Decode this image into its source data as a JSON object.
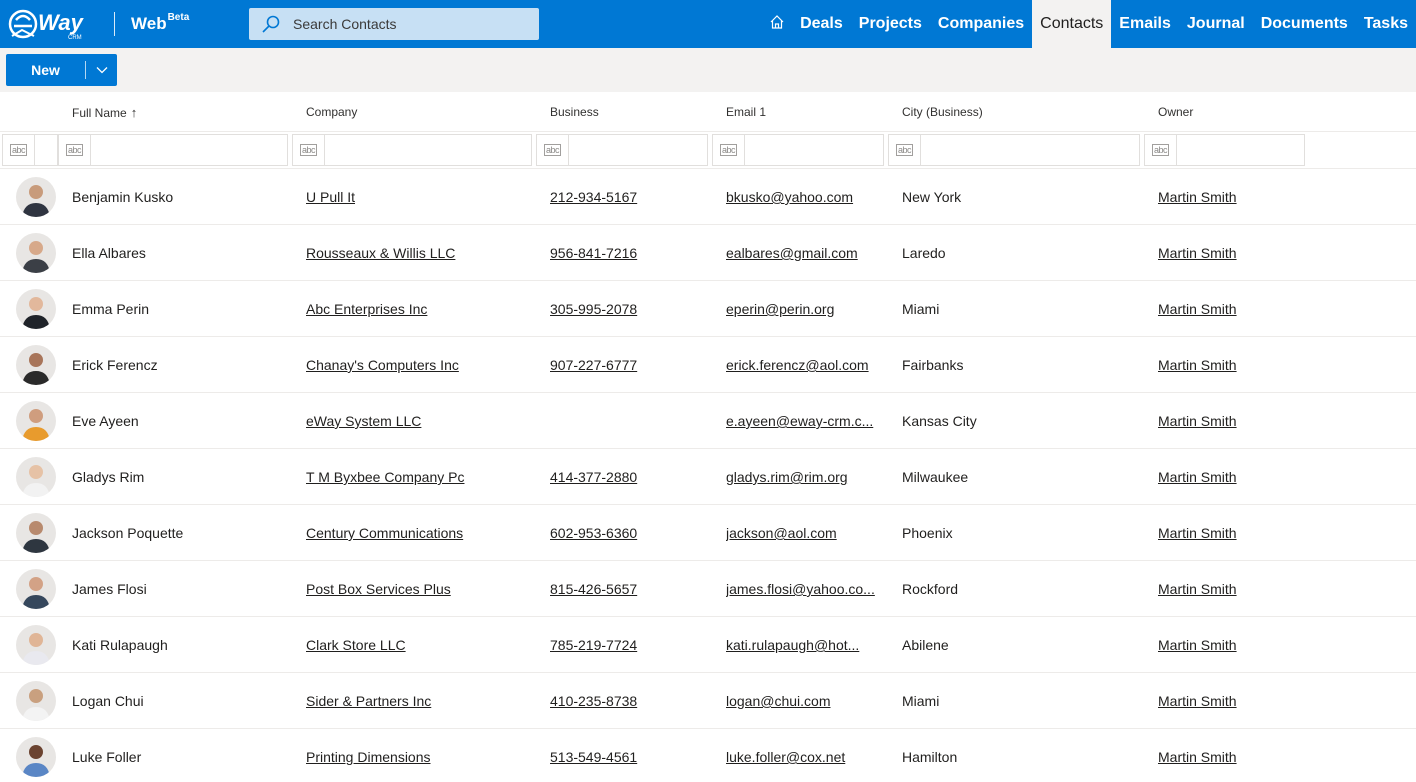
{
  "app": {
    "web_label": "Web",
    "beta_label": "Beta",
    "search_placeholder": "Search Contacts",
    "accent": "#0078d4"
  },
  "nav": {
    "home_icon": "home-icon",
    "items": [
      "Deals",
      "Projects",
      "Companies",
      "Contacts",
      "Emails",
      "Journal",
      "Documents",
      "Tasks"
    ],
    "active": "Contacts"
  },
  "toolbar": {
    "new_label": "New"
  },
  "columns": [
    "Full Name",
    "Company",
    "Business",
    "Email 1",
    "City (Business)",
    "Owner"
  ],
  "sort_indicator": "↑",
  "filter_icon_label": "abc",
  "contacts": [
    {
      "name": "Benjamin Kusko",
      "company": "U Pull It",
      "phone": "212-934-5167",
      "email": "bkusko@yahoo.com",
      "city": "New York",
      "owner": "Martin Smith"
    },
    {
      "name": "Ella Albares",
      "company": "Rousseaux & Willis LLC",
      "phone": "956-841-7216",
      "email": "ealbares@gmail.com",
      "city": "Laredo",
      "owner": "Martin Smith"
    },
    {
      "name": "Emma Perin",
      "company": "Abc Enterprises Inc",
      "phone": "305-995-2078",
      "email": "eperin@perin.org",
      "city": "Miami",
      "owner": "Martin Smith"
    },
    {
      "name": "Erick Ferencz",
      "company": "Chanay's Computers Inc",
      "phone": "907-227-6777",
      "email": "erick.ferencz@aol.com",
      "city": "Fairbanks",
      "owner": "Martin Smith"
    },
    {
      "name": "Eve Ayeen",
      "company": "eWay System LLC",
      "phone": "",
      "email": "e.ayeen@eway-crm.c...",
      "city": "Kansas City",
      "owner": "Martin Smith"
    },
    {
      "name": "Gladys Rim",
      "company": "T M Byxbee Company Pc",
      "phone": "414-377-2880",
      "email": "gladys.rim@rim.org",
      "city": "Milwaukee",
      "owner": "Martin Smith"
    },
    {
      "name": "Jackson Poquette",
      "company": "Century Communications",
      "phone": "602-953-6360",
      "email": "jackson@aol.com",
      "city": "Phoenix",
      "owner": "Martin Smith"
    },
    {
      "name": "James Flosi",
      "company": "Post Box Services Plus",
      "phone": "815-426-5657",
      "email": "james.flosi@yahoo.co...",
      "city": "Rockford",
      "owner": "Martin Smith"
    },
    {
      "name": "Kati Rulapaugh",
      "company": "Clark Store LLC",
      "phone": "785-219-7724",
      "email": "kati.rulapaugh@hot...",
      "city": "Abilene",
      "owner": "Martin Smith"
    },
    {
      "name": "Logan Chui",
      "company": "Sider & Partners Inc",
      "phone": "410-235-8738",
      "email": "logan@chui.com",
      "city": "Miami",
      "owner": "Martin Smith"
    },
    {
      "name": "Luke Foller",
      "company": "Printing Dimensions",
      "phone": "513-549-4561",
      "email": "luke.foller@cox.net",
      "city": "Hamilton",
      "owner": "Martin Smith"
    }
  ]
}
